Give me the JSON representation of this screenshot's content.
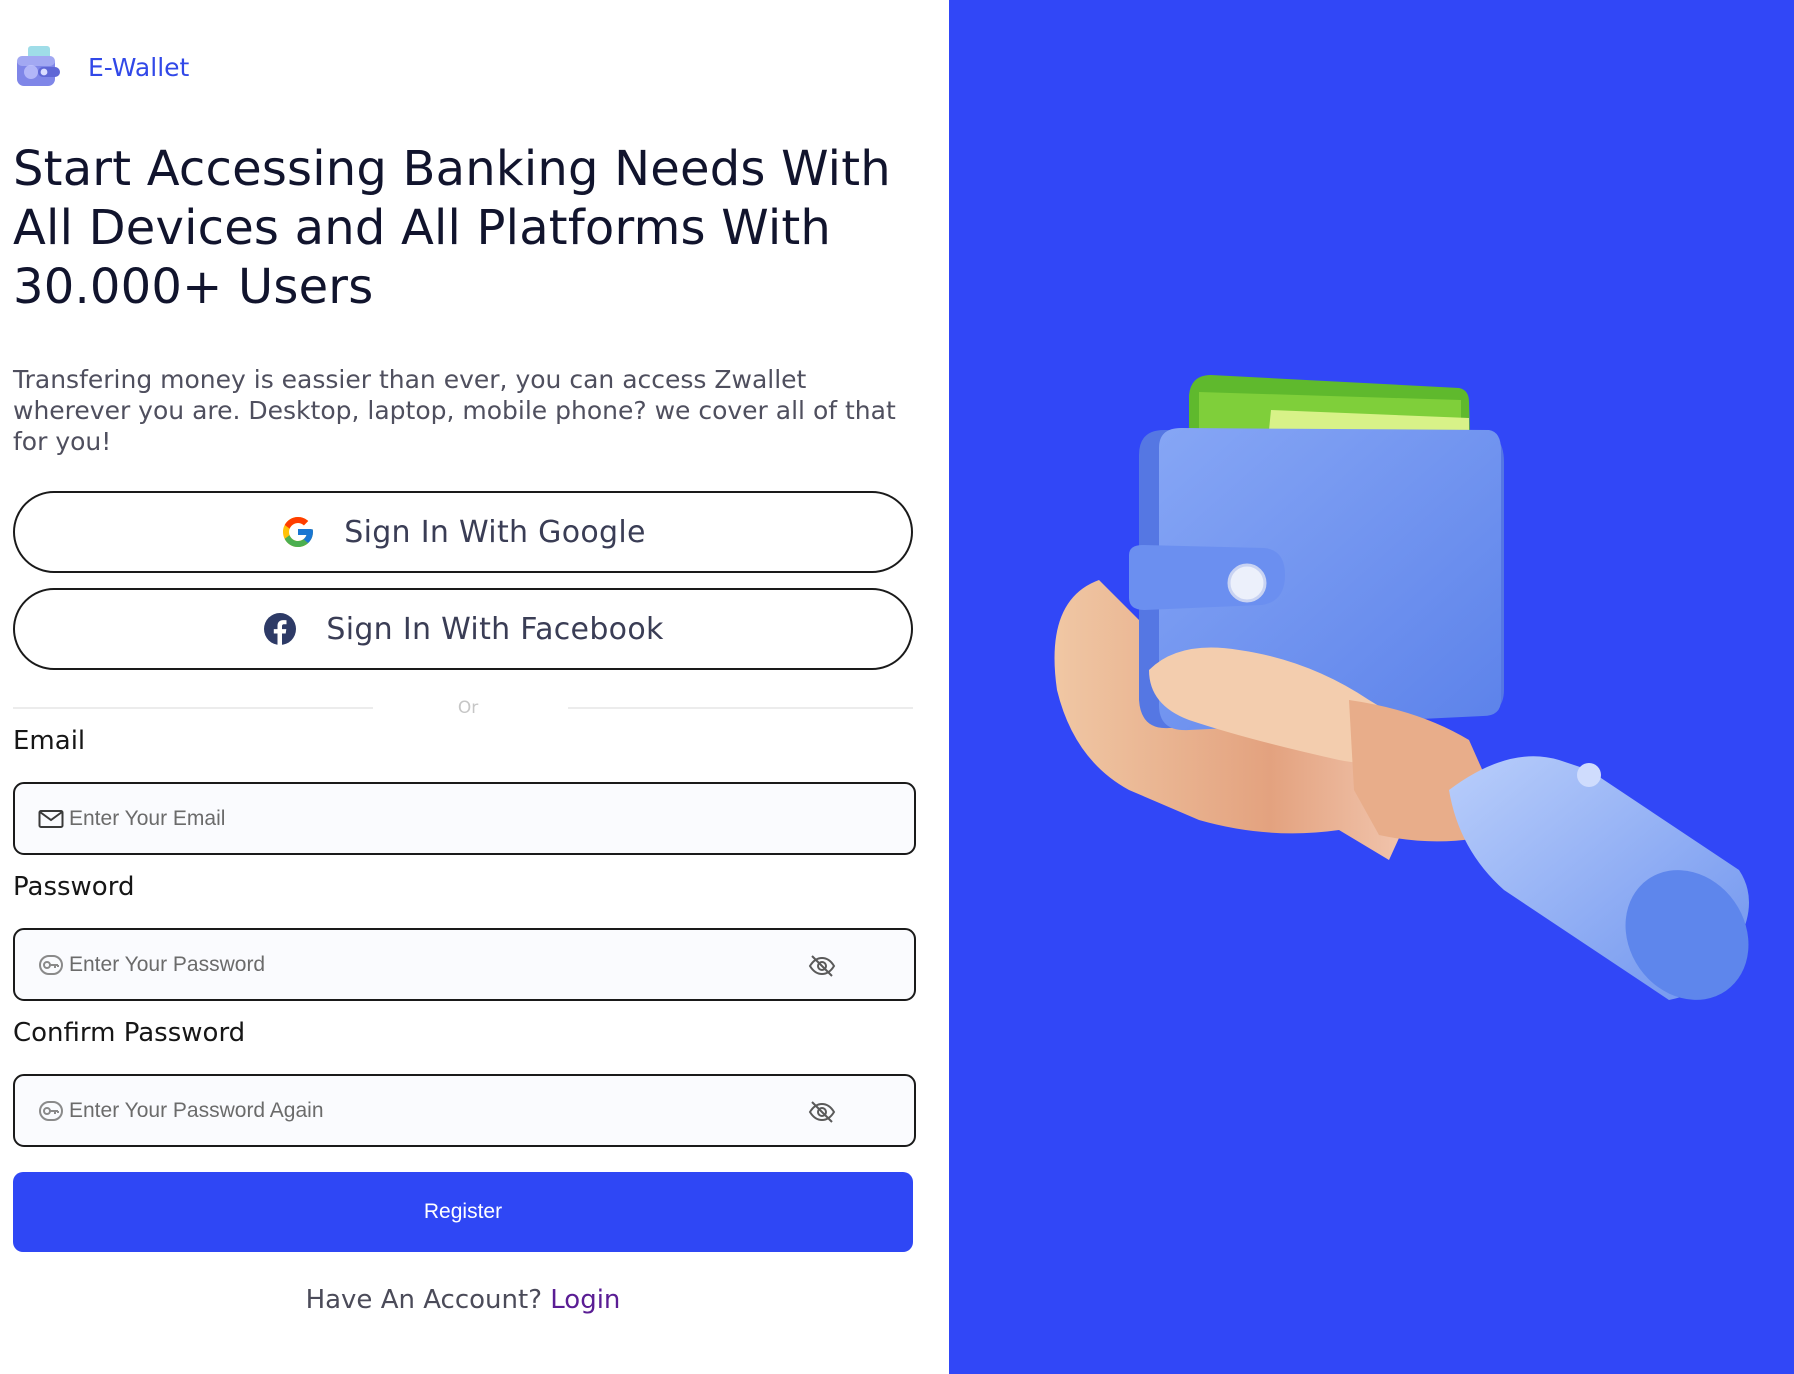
{
  "brand": {
    "name": "E-Wallet",
    "logo_icon": "wallet-icon"
  },
  "hero": {
    "title": "Start Accessing Banking Needs With All Devices and All Platforms With 30.000+ Users",
    "description": "Transfering money is eassier than ever, you can access Zwallet wherever you are. Desktop, laptop, mobile phone? we cover all of that for you!"
  },
  "social": {
    "google_label": "Sign In With Google",
    "facebook_label": "Sign In With Facebook"
  },
  "divider": {
    "text": "Or"
  },
  "form": {
    "email_label": "Email",
    "email_placeholder": "Enter Your Email",
    "password_label": "Password",
    "password_placeholder": "Enter Your Password",
    "confirm_label": "Confirm Password",
    "confirm_placeholder": "Enter Your Password Again",
    "register_label": "Register"
  },
  "footer": {
    "prompt": "Have An Account?",
    "login_label": "Login"
  },
  "colors": {
    "primary": "#2f47f5",
    "panel": "#3147f7",
    "brand_text": "#3148e8",
    "link": "#5a1d94"
  },
  "illustration": {
    "icon": "hand-holding-wallet-icon"
  }
}
